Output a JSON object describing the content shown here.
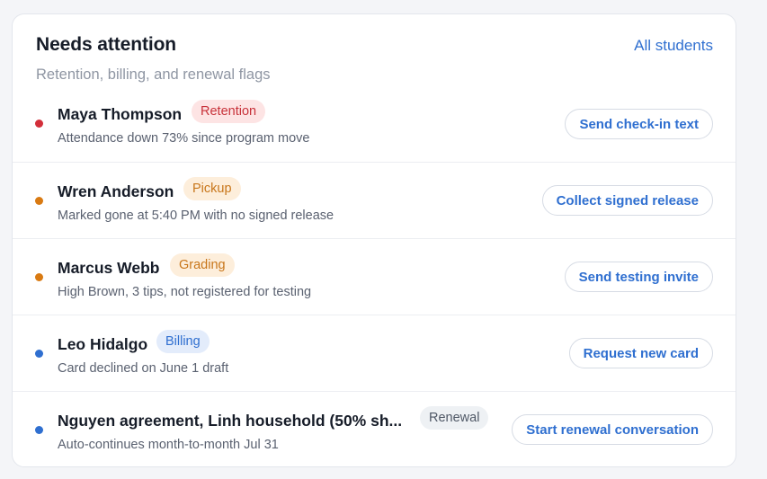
{
  "header": {
    "title": "Needs attention",
    "subtitle": "Retention, billing, and renewal flags",
    "link_label": "All students"
  },
  "items": [
    {
      "name": "Maya Thompson",
      "badge": "Retention",
      "detail": "Attendance down 73% since program move",
      "action": "Send check-in text",
      "dot_color": "#d32f3a",
      "badge_bg": "#fde4e4",
      "badge_fg": "#c8323a"
    },
    {
      "name": "Wren Anderson",
      "badge": "Pickup",
      "detail": "Marked gone at 5:40 PM with no signed release",
      "action": "Collect signed release",
      "dot_color": "#d97a12",
      "badge_bg": "#fdeedb",
      "badge_fg": "#c8761a"
    },
    {
      "name": "Marcus Webb",
      "badge": "Grading",
      "detail": "High Brown, 3 tips, not registered for testing",
      "action": "Send testing invite",
      "dot_color": "#d97a12",
      "badge_bg": "#fdeedb",
      "badge_fg": "#c8761a"
    },
    {
      "name": "Leo Hidalgo",
      "badge": "Billing",
      "detail": "Card declined on June 1 draft",
      "action": "Request new card",
      "dot_color": "#2f6fd0",
      "badge_bg": "#e3ecfb",
      "badge_fg": "#2f6fd0"
    },
    {
      "name": "Nguyen agreement, Linh household (50% sh...",
      "badge": "Renewal",
      "detail": "Auto-continues month-to-month Jul 31",
      "action": "Start renewal conversation",
      "dot_color": "#2f6fd0",
      "badge_bg": "#eef1f4",
      "badge_fg": "#4f5866"
    }
  ]
}
